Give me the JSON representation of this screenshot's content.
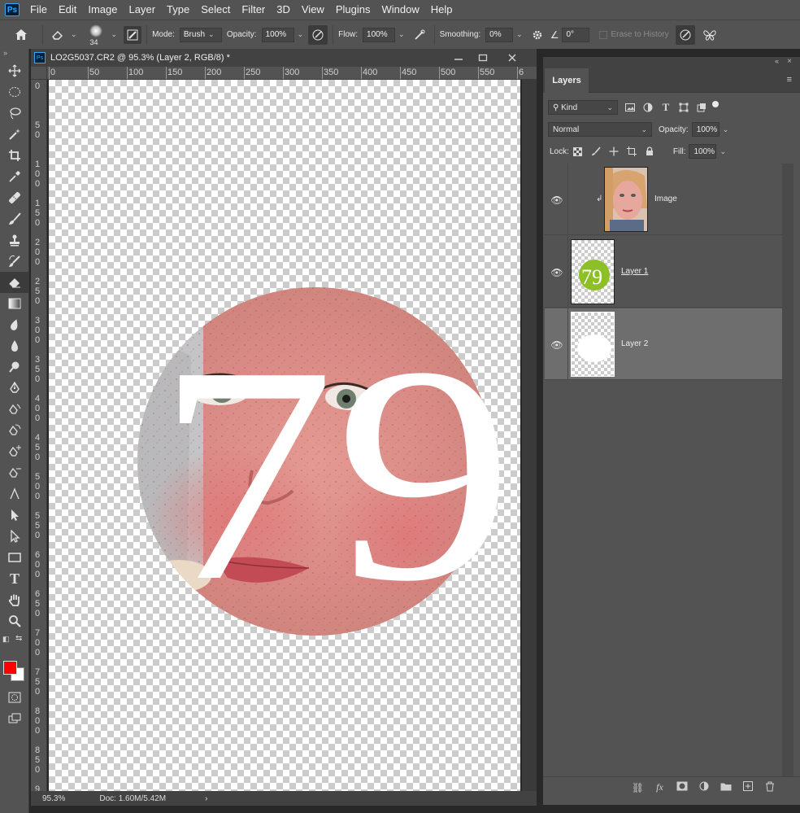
{
  "menu": [
    "File",
    "Edit",
    "Image",
    "Layer",
    "Type",
    "Select",
    "Filter",
    "3D",
    "View",
    "Plugins",
    "Window",
    "Help"
  ],
  "app_logo": "Ps",
  "options": {
    "brush_size": "34",
    "mode_label": "Mode:",
    "mode_value": "Brush",
    "opacity_label": "Opacity:",
    "opacity_value": "100%",
    "flow_label": "Flow:",
    "flow_value": "100%",
    "smoothing_label": "Smoothing:",
    "smoothing_value": "0%",
    "angle_value": "0°",
    "erase_history_label": "Erase to History"
  },
  "document": {
    "tab_title": "LO2G5037.CR2 @ 95.3% (Layer 2, RGB/8) *",
    "ruler_top": [
      "0",
      "50",
      "100",
      "150",
      "200",
      "250",
      "300",
      "350",
      "400",
      "450",
      "500",
      "550",
      "6"
    ],
    "ruler_left": [
      "0",
      "5\n0",
      "1\n0\n0",
      "1\n5\n0",
      "2\n0\n0",
      "2\n5\n0",
      "3\n0\n0",
      "3\n5\n0",
      "4\n0\n0",
      "4\n5\n0",
      "5\n0\n0",
      "5\n5\n0",
      "6\n0\n0",
      "6\n5\n0",
      "7\n0\n0",
      "7\n5\n0",
      "8\n0\n0",
      "8\n5\n0",
      "9"
    ],
    "canvas_text": "79",
    "zoom": "95.3%",
    "doc_size": "Doc: 1.60M/5.42M"
  },
  "layers_panel": {
    "tab_label": "Layers",
    "filter_kind": "Kind",
    "blend_mode": "Normal",
    "opacity_label": "Opacity:",
    "opacity_value": "100%",
    "lock_label": "Lock:",
    "fill_label": "Fill:",
    "fill_value": "100%",
    "layers": [
      {
        "name": "Image",
        "visible": true,
        "clipped": true
      },
      {
        "name": "Layer 1",
        "visible": true,
        "clipped": false
      },
      {
        "name": "Layer 2",
        "visible": true,
        "clipped": false,
        "selected": true
      }
    ]
  },
  "colors": {
    "foreground": "#ff0000",
    "background": "#ffffff",
    "layer1_green": "#8dc026"
  }
}
